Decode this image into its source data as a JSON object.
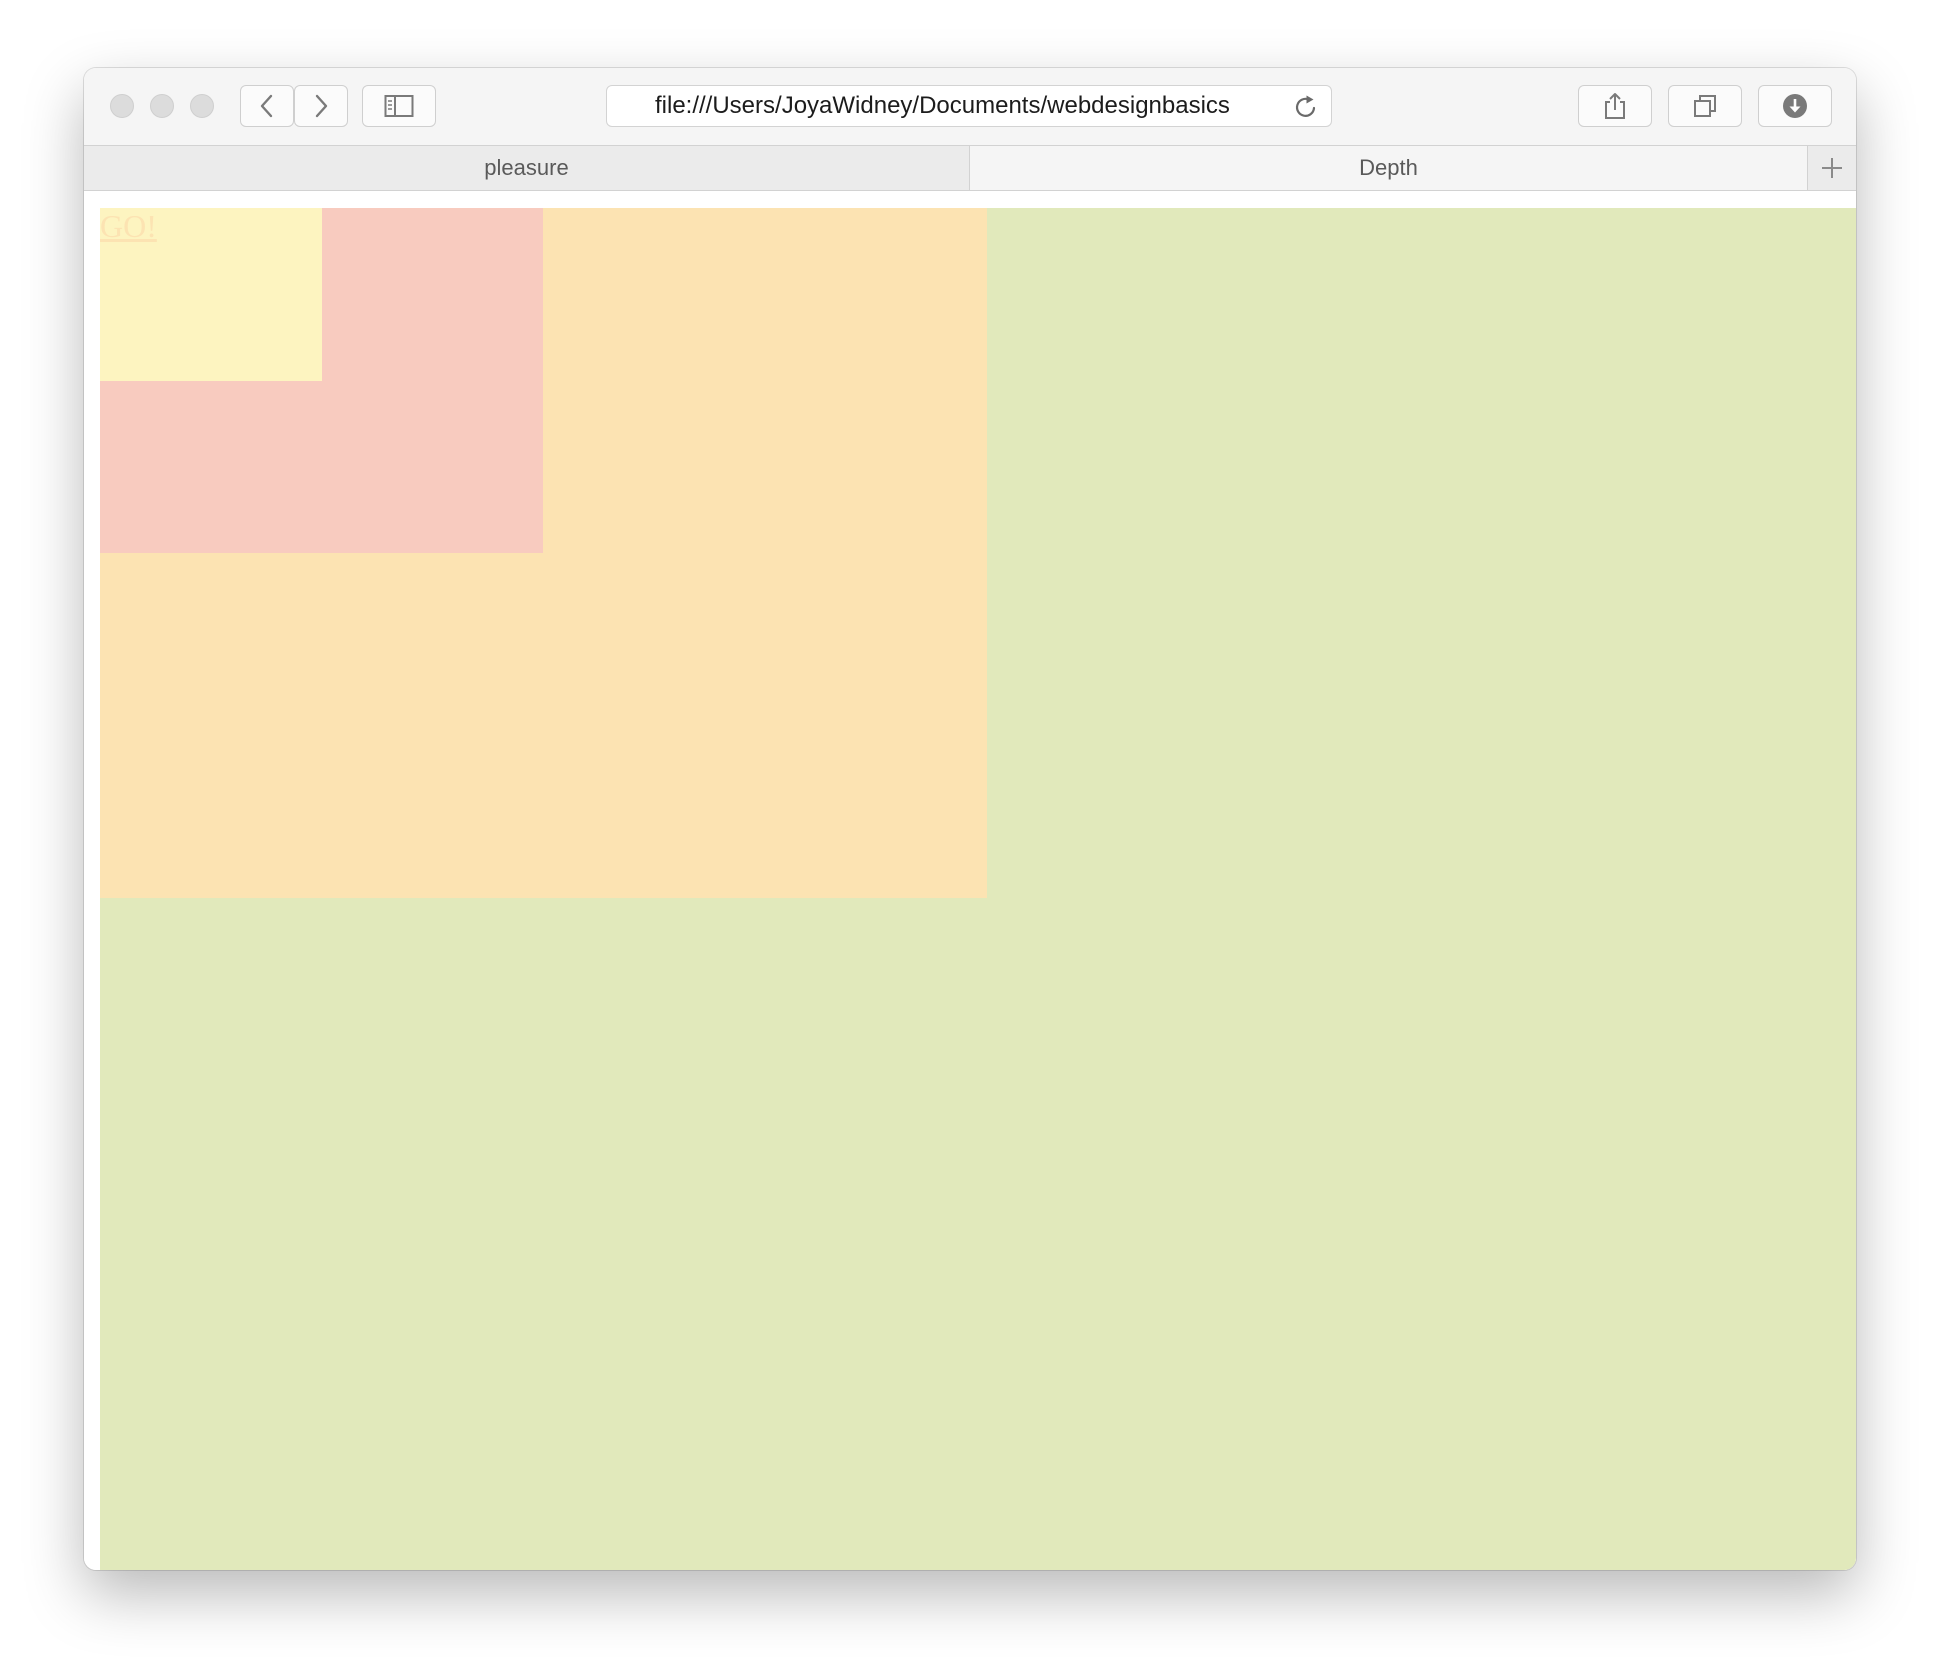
{
  "browser": {
    "url": "file:///Users/JoyaWidney/Documents/webdesignbasics",
    "tabs": [
      {
        "label": "pleasure",
        "active": false
      },
      {
        "label": "Depth",
        "active": true
      }
    ]
  },
  "page": {
    "link_text": "GO!",
    "colors": {
      "outer_green": "#e1e9bb",
      "orange": "#fce3b2",
      "pink": "#f8cbbf",
      "yellow": "#fdf4c0",
      "link": "#fce3b2"
    }
  }
}
